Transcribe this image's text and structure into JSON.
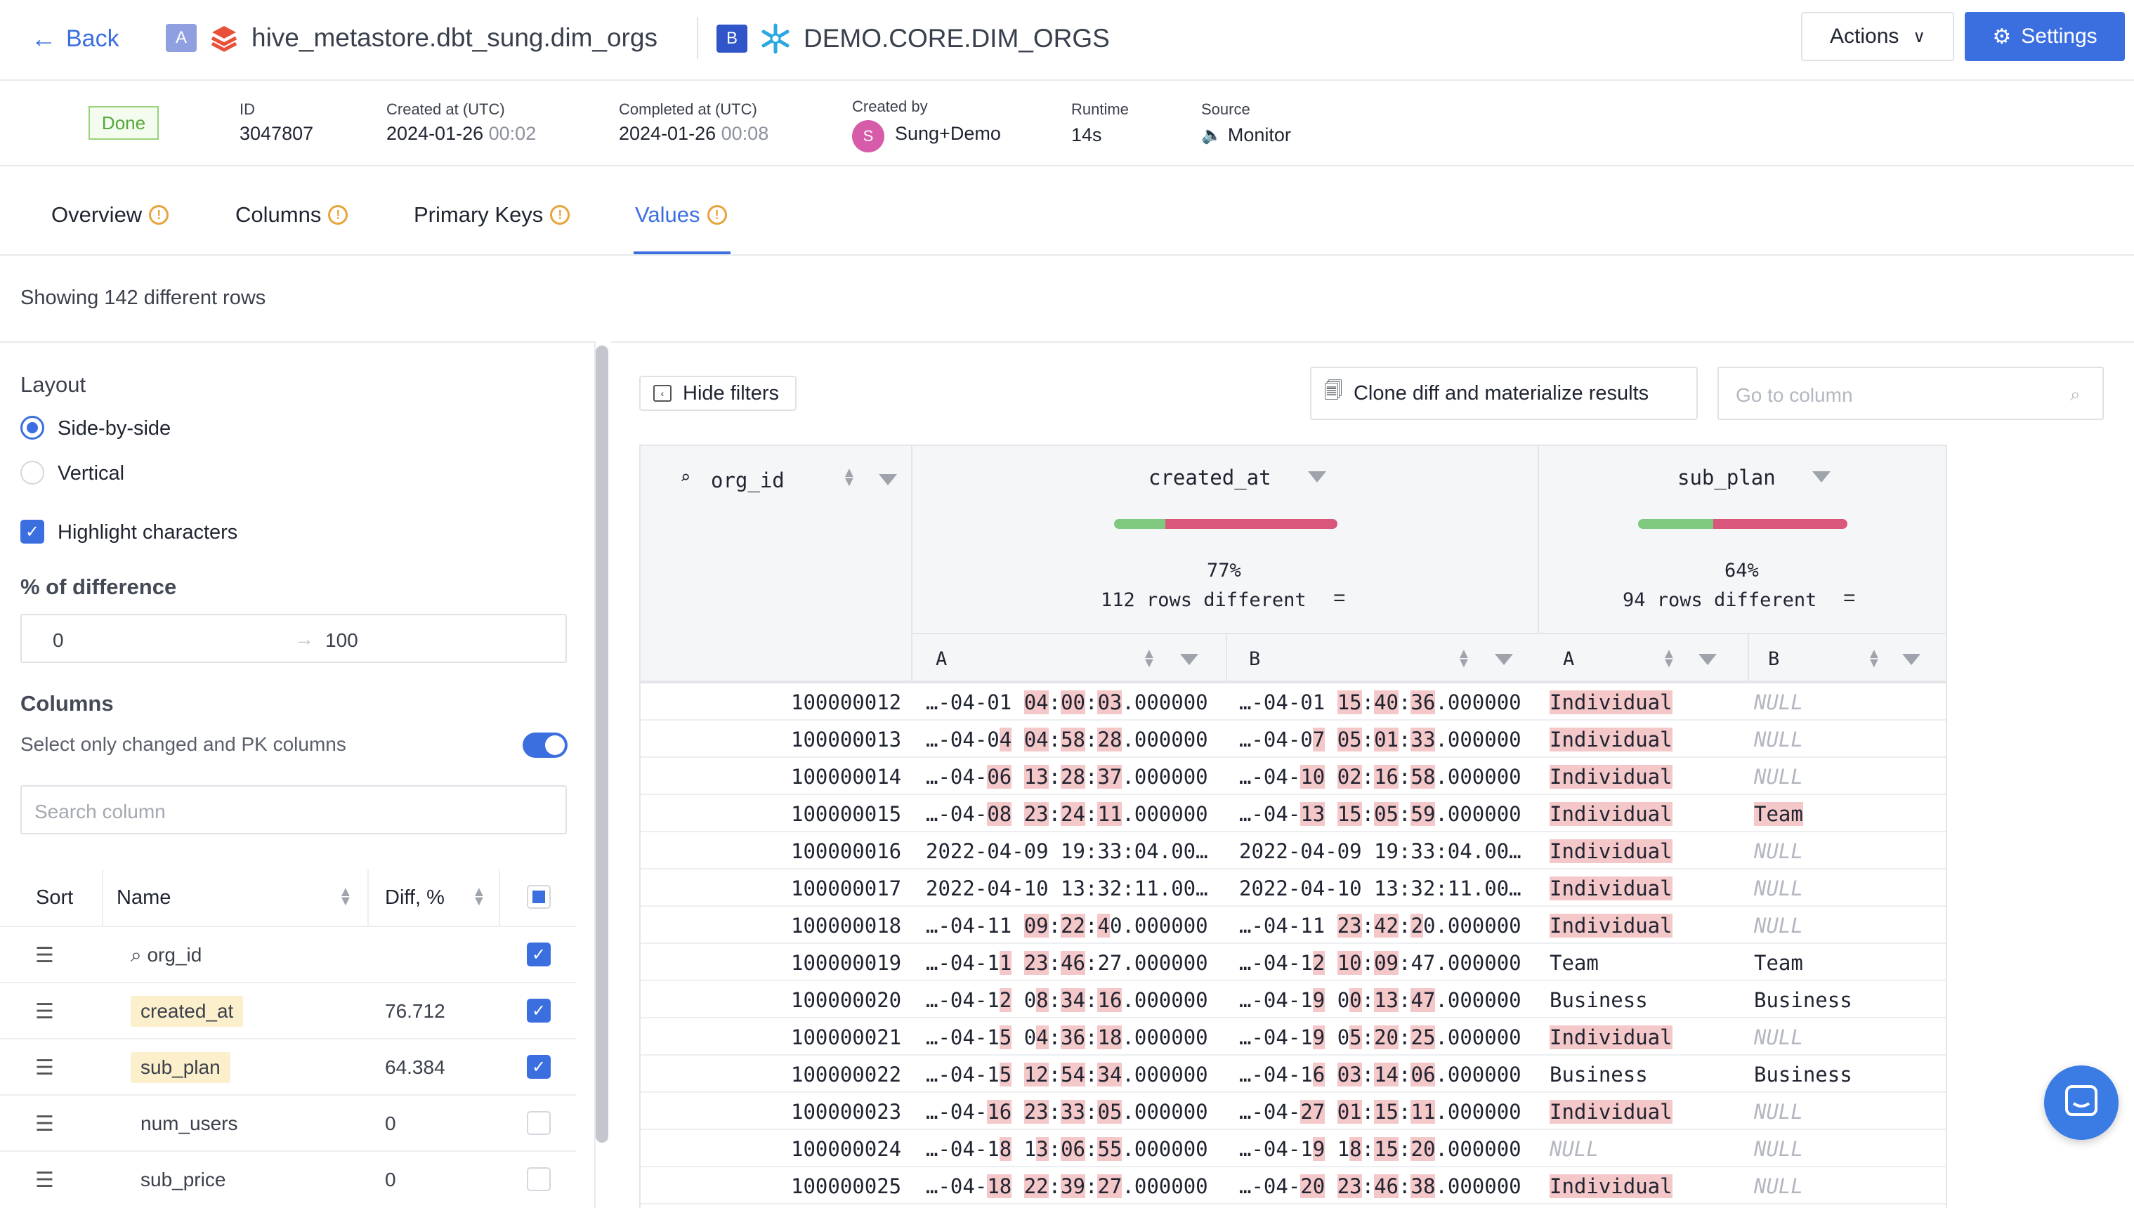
{
  "header": {
    "back_label": "Back",
    "a_badge": "A",
    "a_table": "hive_metastore.dbt_sung.dim_orgs",
    "b_badge": "B",
    "b_table": "DEMO.CORE.DIM_ORGS",
    "actions_label": "Actions",
    "settings_label": "Settings"
  },
  "meta": {
    "status": "Done",
    "id_label": "ID",
    "id_value": "3047807",
    "created_label": "Created at (UTC)",
    "created_date": "2024-01-26",
    "created_time": "00:02",
    "completed_label": "Completed at (UTC)",
    "completed_date": "2024-01-26",
    "completed_time": "00:08",
    "created_by_label": "Created by",
    "avatar_letter": "S",
    "created_by": "Sung+Demo",
    "runtime_label": "Runtime",
    "runtime": "14s",
    "source_label": "Source",
    "source": "Monitor"
  },
  "tabs": [
    "Overview",
    "Columns",
    "Primary Keys",
    "Values"
  ],
  "active_tab": "Values",
  "summary": "Showing 142 different rows",
  "sidebar": {
    "layout_title": "Layout",
    "side_by_side": "Side-by-side",
    "vertical": "Vertical",
    "highlight": "Highlight characters",
    "diff_title": "% of difference",
    "diff_min": "0",
    "diff_max": "100",
    "columns_title": "Columns",
    "changed_only": "Select only changed and PK columns",
    "search_placeholder": "Search column",
    "col_sort": "Sort",
    "col_name": "Name",
    "col_diff": "Diff, %",
    "columns": [
      {
        "name": "org_id",
        "diff": "",
        "checked": true,
        "pk": true,
        "changed": false
      },
      {
        "name": "created_at",
        "diff": "76.712",
        "checked": true,
        "pk": false,
        "changed": true
      },
      {
        "name": "sub_plan",
        "diff": "64.384",
        "checked": true,
        "pk": false,
        "changed": true
      },
      {
        "name": "num_users",
        "diff": "0",
        "checked": false,
        "pk": false,
        "changed": false
      },
      {
        "name": "sub_price",
        "diff": "0",
        "checked": false,
        "pk": false,
        "changed": false
      }
    ]
  },
  "toolbar": {
    "hide_filters": "Hide filters",
    "clone": "Clone diff and materialize results",
    "goto_placeholder": "Go to column"
  },
  "grid": {
    "pk_header": "org_id",
    "created_header": "created_at",
    "created_pct": "77%",
    "created_pct_value": 77,
    "created_rows": "112 rows different",
    "plan_header": "sub_plan",
    "plan_pct": "64%",
    "plan_pct_value": 64,
    "plan_rows": "94 rows different",
    "sub_a": "A",
    "sub_b": "B",
    "colors": {
      "same": "#7ec97e",
      "diff": "#d9577a",
      "highlight": "#f4c7c9"
    }
  },
  "rows": [
    {
      "id": "100000012",
      "ca": "…-04-01 [04]:[00]:[03].000000",
      "cb": "…-04-01 [15]:[40]:[36].000000",
      "pa": "[Individual]",
      "pb": "NULL"
    },
    {
      "id": "100000013",
      "ca": "…-04-0[4] [04]:[58]:[28].000000",
      "cb": "…-04-0[7] [05]:[01]:[33].000000",
      "pa": "[Individual]",
      "pb": "NULL"
    },
    {
      "id": "100000014",
      "ca": "…-04-[06] [13]:[28]:[37].000000",
      "cb": "…-04-[10] [02]:[16]:[58].000000",
      "pa": "[Individual]",
      "pb": "NULL"
    },
    {
      "id": "100000015",
      "ca": "…-04-[08] [23]:[24]:[11].000000",
      "cb": "…-04-[13] [15]:[05]:[59].000000",
      "pa": "[Individual]",
      "pb": "[Team]"
    },
    {
      "id": "100000016",
      "ca": "2022-04-09 19:33:04.00…",
      "cb": "2022-04-09 19:33:04.00…",
      "pa": "[Individual]",
      "pb": "NULL"
    },
    {
      "id": "100000017",
      "ca": "2022-04-10 13:32:11.00…",
      "cb": "2022-04-10 13:32:11.00…",
      "pa": "[Individual]",
      "pb": "NULL"
    },
    {
      "id": "100000018",
      "ca": "…-04-11 [09]:[22]:[4]0.000000",
      "cb": "…-04-11 [23]:[42]:[2]0.000000",
      "pa": "[Individual]",
      "pb": "NULL"
    },
    {
      "id": "100000019",
      "ca": "…-04-1[1] [23]:[46]:27.000000",
      "cb": "…-04-1[2] [10]:[09]:47.000000",
      "pa": "Team",
      "pb": "Team"
    },
    {
      "id": "100000020",
      "ca": "…-04-1[2] 0[8]:[34]:[16].000000",
      "cb": "…-04-1[9] 0[0]:[13]:[47].000000",
      "pa": "Business",
      "pb": "Business"
    },
    {
      "id": "100000021",
      "ca": "…-04-1[5] 0[4]:[36]:[18].000000",
      "cb": "…-04-1[9] 0[5]:[20]:[25].000000",
      "pa": "[Individual]",
      "pb": "NULL"
    },
    {
      "id": "100000022",
      "ca": "…-04-1[5] [12]:[54]:[34].000000",
      "cb": "…-04-1[6] [03]:[14]:[06].000000",
      "pa": "Business",
      "pb": "Business"
    },
    {
      "id": "100000023",
      "ca": "…-04-[16] [23]:[33]:[05].000000",
      "cb": "…-04-[27] [01]:[15]:[11].000000",
      "pa": "[Individual]",
      "pb": "NULL"
    },
    {
      "id": "100000024",
      "ca": "…-04-1[8] 1[3]:[06]:[55].000000",
      "cb": "…-04-1[9] 1[8]:[15]:[20].000000",
      "pa": "NULL",
      "pb": "NULL"
    },
    {
      "id": "100000025",
      "ca": "…-04-[18] [22]:[39]:[27].000000",
      "cb": "…-04-[20] [23]:[46]:[38].000000",
      "pa": "[Individual]",
      "pb": "NULL"
    }
  ]
}
